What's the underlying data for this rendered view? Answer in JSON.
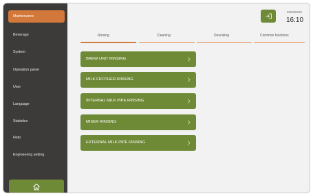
{
  "sidebar": {
    "items": [
      {
        "label": "Maintenance",
        "active": true
      },
      {
        "label": "Beverage"
      },
      {
        "label": "System"
      },
      {
        "label": "Operation panel"
      },
      {
        "label": "User"
      },
      {
        "label": "Language"
      },
      {
        "label": "Statistics"
      },
      {
        "label": "Help"
      },
      {
        "label": "Engineering setting"
      }
    ],
    "home_icon": "home-icon"
  },
  "header": {
    "date": "2023/03/22",
    "time": "16:10",
    "logout_icon": "logout-icon"
  },
  "tabs": [
    {
      "label": "Rinsing",
      "active": true
    },
    {
      "label": "Cleaning"
    },
    {
      "label": "Descaling"
    },
    {
      "label": "Common functions"
    }
  ],
  "rinsing_buttons": [
    {
      "label": "BREW UNIT RINSING"
    },
    {
      "label": "MILK FROTHER RINSING"
    },
    {
      "label": "INTERNAL MILK PIPE RINSING"
    },
    {
      "label": "MIXER RINSING"
    },
    {
      "label": "EXTERNAL MILK PIPE RINSING"
    }
  ],
  "colors": {
    "sidebar_bg": "#3c3b39",
    "active_orange": "#d2783a",
    "button_green": "#6f8a37",
    "content_bg": "#f2f2f2"
  }
}
